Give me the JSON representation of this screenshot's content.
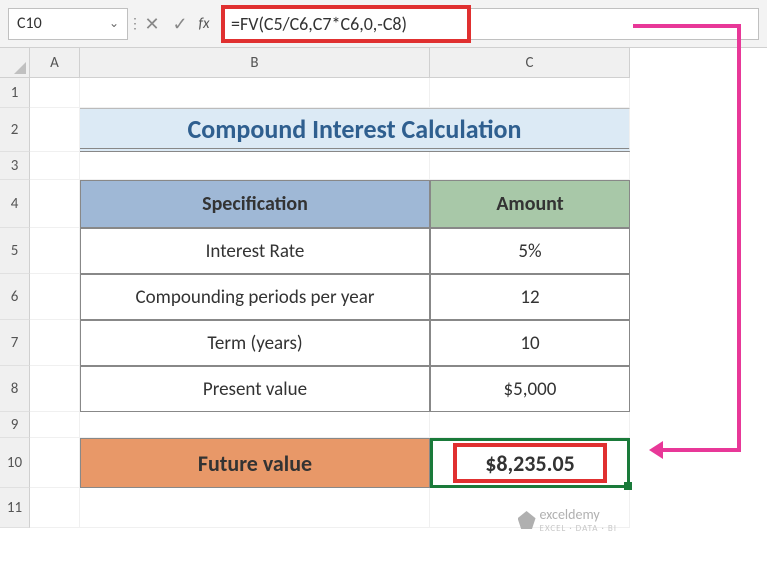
{
  "name_box": "C10",
  "formula": "=FV(C5/C6,C7*C6,0,-C8)",
  "fx_label": "fx",
  "columns": [
    "A",
    "B",
    "C"
  ],
  "rows": [
    "1",
    "2",
    "3",
    "4",
    "5",
    "6",
    "7",
    "8",
    "9",
    "10",
    "11"
  ],
  "title": "Compound Interest Calculation",
  "table": {
    "headers": {
      "spec": "Specification",
      "amount": "Amount"
    },
    "rows": [
      {
        "spec": "Interest Rate",
        "amount": "5%"
      },
      {
        "spec": "Compounding periods per year",
        "amount": "12"
      },
      {
        "spec": "Term (years)",
        "amount": "10"
      },
      {
        "spec": "Present value",
        "amount": "$5,000"
      }
    ]
  },
  "future": {
    "label": "Future value",
    "value": "$8,235.05"
  },
  "watermark": {
    "brand": "exceldemy",
    "tagline": "EXCEL · DATA · BI"
  },
  "icons": {
    "dropdown": "⌄",
    "cancel": "✕",
    "confirm": "✓",
    "divider": "⋮"
  },
  "chart_data": {
    "type": "table",
    "title": "Compound Interest Calculation",
    "columns": [
      "Specification",
      "Amount"
    ],
    "rows": [
      [
        "Interest Rate",
        "5%"
      ],
      [
        "Compounding periods per year",
        12
      ],
      [
        "Term (years)",
        10
      ],
      [
        "Present value",
        5000
      ],
      [
        "Future value",
        8235.05
      ]
    ],
    "formula": "=FV(C5/C6,C7*C6,0,-C8)",
    "active_cell": "C10"
  }
}
